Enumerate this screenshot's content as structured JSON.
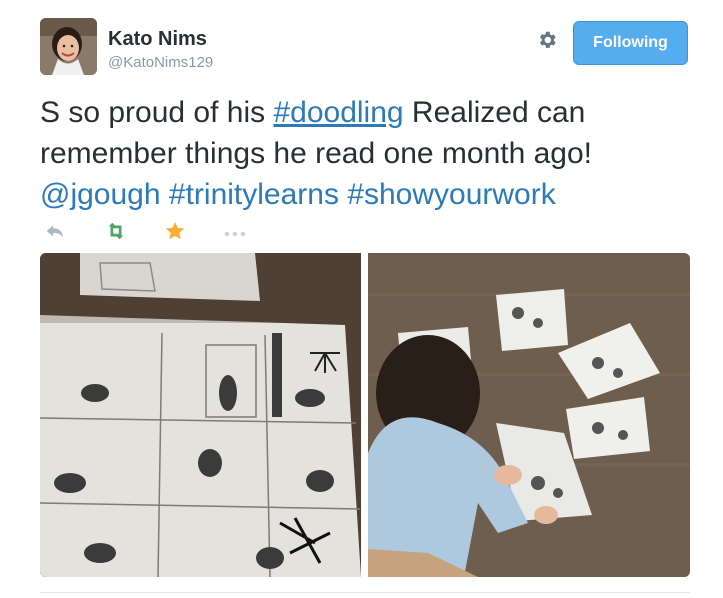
{
  "user": {
    "display_name": "Kato Nims",
    "handle": "@KatoNims129"
  },
  "follow_button": {
    "label": "Following"
  },
  "tweet": {
    "text_part1": "S so proud of his ",
    "hashtag1": "#doodling",
    "text_part2": " Realized can remember things he read one month ago! ",
    "mention": "@jgough",
    "hashtag2": "#trinitylearns",
    "hashtag3": "#showyourwork"
  },
  "actions": {
    "reply_icon": "reply-icon",
    "retweet_icon": "retweet-icon",
    "favorite_icon": "star-icon",
    "more_icon": "more-icon"
  },
  "colors": {
    "link": "#2b7bb9",
    "follow_bg": "#55acee",
    "retweet": "#4da56a",
    "favorite": "#ffac33",
    "muted": "#8899a6"
  },
  "photos": [
    {
      "description_name": "doodle-comic-strip-photo"
    },
    {
      "description_name": "child-drawing-on-floor-photo"
    }
  ]
}
